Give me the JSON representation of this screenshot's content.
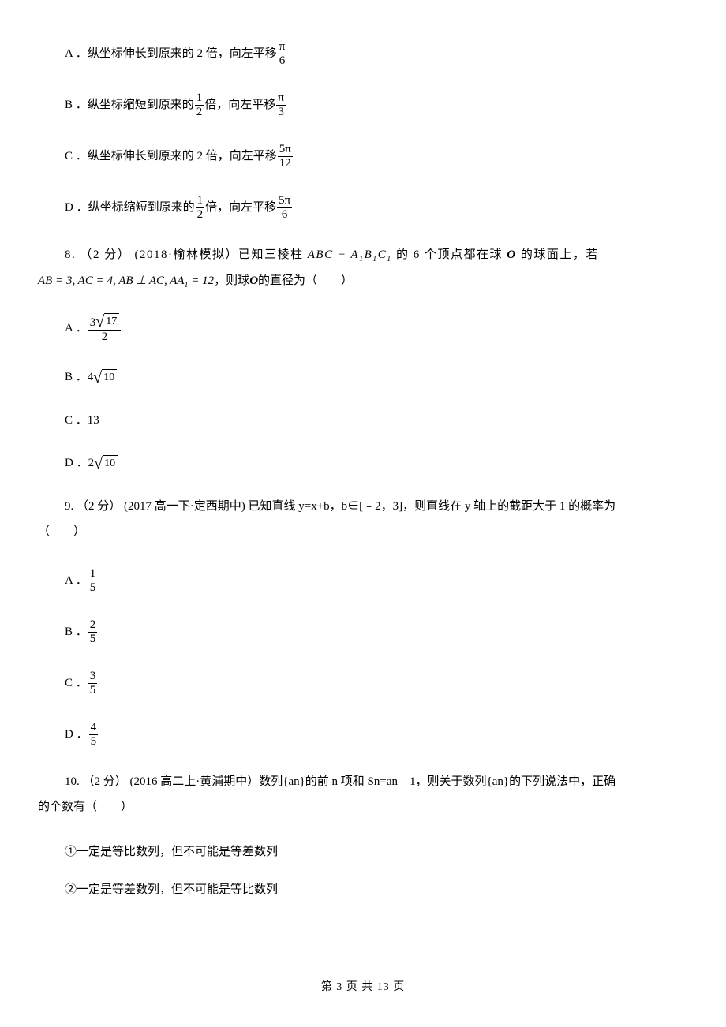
{
  "q7": {
    "A_pre": "A ．纵坐标伸长到原来的 2 倍，向左平移",
    "A_num": "π",
    "A_den": "6",
    "B_pre": "B ．纵坐标缩短到原来的",
    "B_num1": "1",
    "B_den1": "2",
    "B_mid": "倍，向左平移",
    "B_num2": "π",
    "B_den2": "3",
    "C_pre": "C ．纵坐标伸长到原来的 2 倍，向左平移",
    "C_num": "5π",
    "C_den": "12",
    "D_pre": "D ．纵坐标缩短到原来的",
    "D_num1": "1",
    "D_den1": "2",
    "D_mid": "倍，向左平移",
    "D_num2": "5π",
    "D_den2": "6"
  },
  "q8": {
    "line1_a": "8. （2 分） (2018·榆林模拟）已知三棱柱 ",
    "expr1": "ABC − A",
    "sub1": "1",
    "expr1b": "B",
    "sub2": "1",
    "expr1c": "C",
    "sub3": "1",
    "line1_b": " 的 6 个顶点都在球 ",
    "O": "O",
    "line1_c": " 的球面上，若",
    "line2_expr": "AB = 3, AC = 4, AB ⊥ AC, AA",
    "sub4": "1",
    "line2_expr_b": " = 12",
    "line2_mid": " ，则球 ",
    "line2_c": " 的直径为（　　）",
    "A_label": "A ．",
    "A_coef": "3",
    "A_rad": "17",
    "A_den": "2",
    "B_label": "B ．",
    "B_coef": "4",
    "B_rad": "10",
    "C_label": "C ．13",
    "D_label": "D ．",
    "D_coef": "2",
    "D_rad": "10"
  },
  "q9": {
    "line1": "9. （2 分） (2017 高一下·定西期中) 已知直线 y=x+b，b∈[﹣2，3]，则直线在 y 轴上的截距大于 1 的概率为",
    "line2": "（　　）",
    "A_label": "A ．",
    "A_num": "1",
    "A_den": "5",
    "B_label": "B ．",
    "B_num": "2",
    "B_den": "5",
    "C_label": "C ．",
    "C_num": "3",
    "C_den": "5",
    "D_label": "D ．",
    "D_num": "4",
    "D_den": "5"
  },
  "q10": {
    "line1": "10. （2 分） (2016 高二上·黄浦期中）数列{an}的前 n 项和 Sn=an﹣1，则关于数列{an}的下列说法中，正确",
    "line2": "的个数有（　　）",
    "s1": "①一定是等比数列，但不可能是等差数列",
    "s2": "②一定是等差数列，但不可能是等比数列"
  },
  "footer": "第 3 页 共 13 页"
}
